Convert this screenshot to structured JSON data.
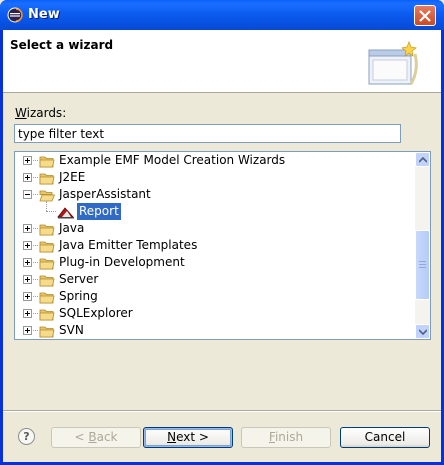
{
  "window": {
    "title": "New",
    "close_label": "×"
  },
  "banner": {
    "title": "Select a wizard"
  },
  "filter": {
    "label": "Wizards:",
    "label_mnemonic": "W",
    "label_rest": "izards:",
    "value": "type filter text"
  },
  "tree": {
    "items": [
      {
        "label": "Example EMF Model Creation Wizards",
        "expanded": false,
        "level": 0
      },
      {
        "label": "J2EE",
        "expanded": false,
        "level": 0
      },
      {
        "label": "JasperAssistant",
        "expanded": true,
        "level": 0
      },
      {
        "label": "Report",
        "level": 1,
        "selected": true
      },
      {
        "label": "Java",
        "expanded": false,
        "level": 0
      },
      {
        "label": "Java Emitter Templates",
        "expanded": false,
        "level": 0
      },
      {
        "label": "Plug-in Development",
        "expanded": false,
        "level": 0
      },
      {
        "label": "Server",
        "expanded": false,
        "level": 0
      },
      {
        "label": "Spring",
        "expanded": false,
        "level": 0
      },
      {
        "label": "SQLExplorer",
        "expanded": false,
        "level": 0
      },
      {
        "label": "SVN",
        "expanded": false,
        "level": 0
      }
    ]
  },
  "buttons": {
    "help": "?",
    "back": "< Back",
    "back_mnemonic": "B",
    "next": "Next >",
    "next_mnemonic": "N",
    "finish": "Finish",
    "finish_mnemonic": "F",
    "cancel": "Cancel"
  },
  "colors": {
    "selection": "#316ac5",
    "titlebar": "#0a5ae8",
    "folder": "#e8c567"
  }
}
